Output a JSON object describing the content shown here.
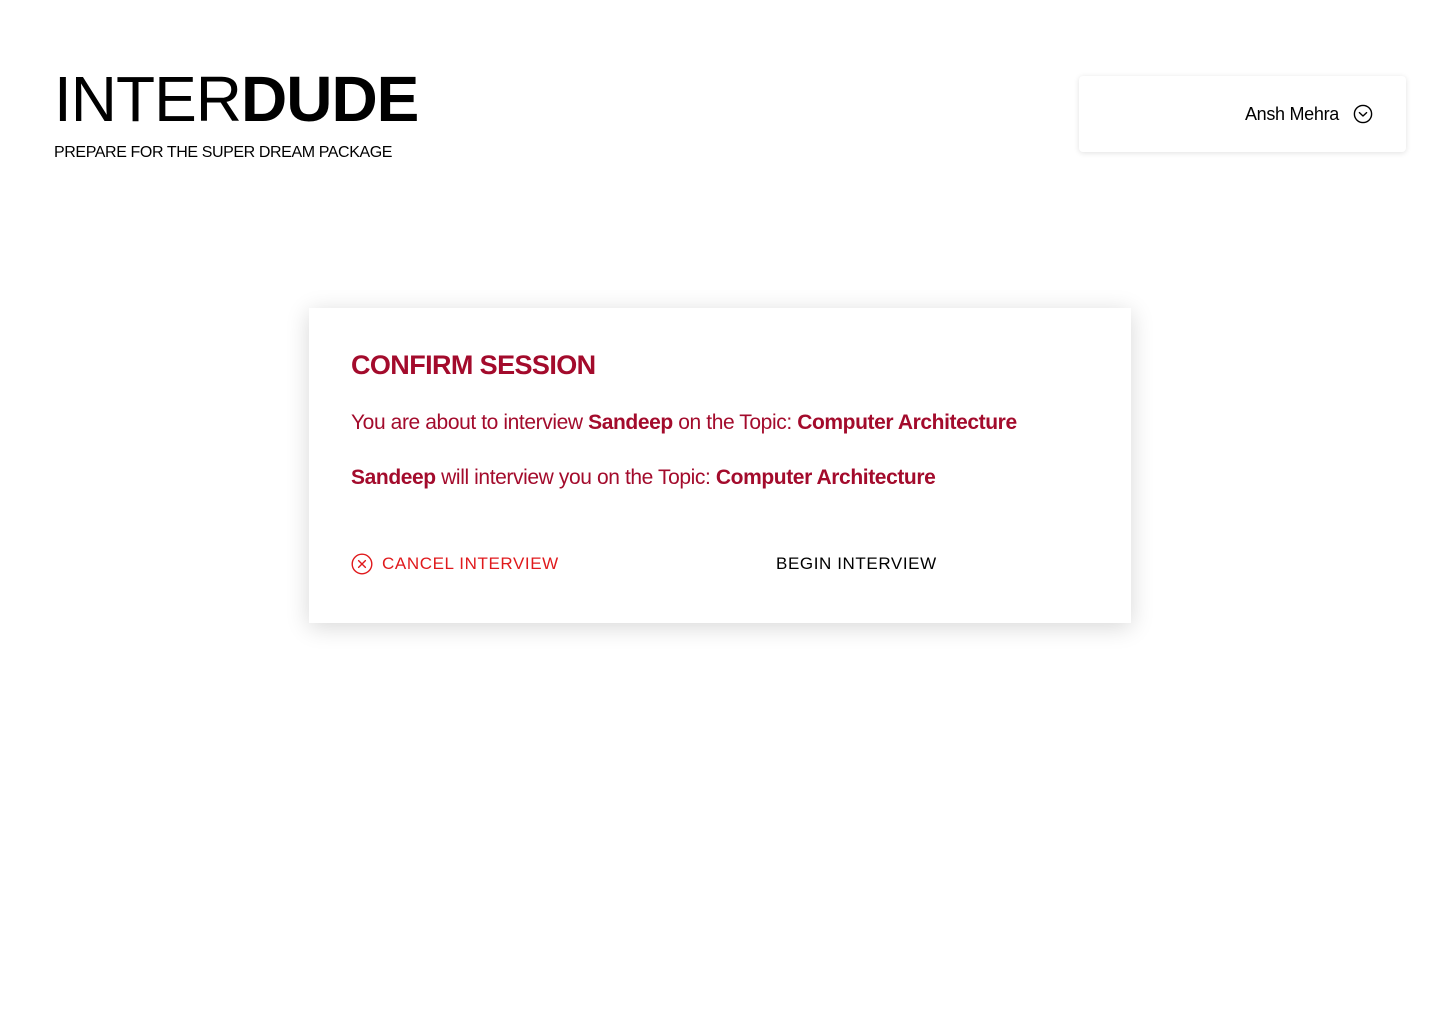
{
  "brand": {
    "title_light": "INTER",
    "title_bold": "DUDE",
    "tagline": "PREPARE FOR THE SUPER DREAM PACKAGE"
  },
  "user": {
    "name": "Ansh Mehra",
    "menu_icon": "chevron-down-circle-icon"
  },
  "modal": {
    "title": "CONFIRM SESSION",
    "line1": {
      "prefix": "You are about to interview ",
      "person": "Sandeep",
      "middle": " on the Topic: ",
      "topic": "Computer Architecture"
    },
    "line2": {
      "person": "Sandeep",
      "middle": " will interview you on the Topic: ",
      "topic": "Computer Architecture"
    },
    "cancel_label": "CANCEL INTERVIEW",
    "cancel_icon": "close-circle-icon",
    "begin_label": "BEGIN INTERVIEW"
  },
  "colors": {
    "accent": "#a30b2c",
    "cancel": "#e0191c"
  }
}
